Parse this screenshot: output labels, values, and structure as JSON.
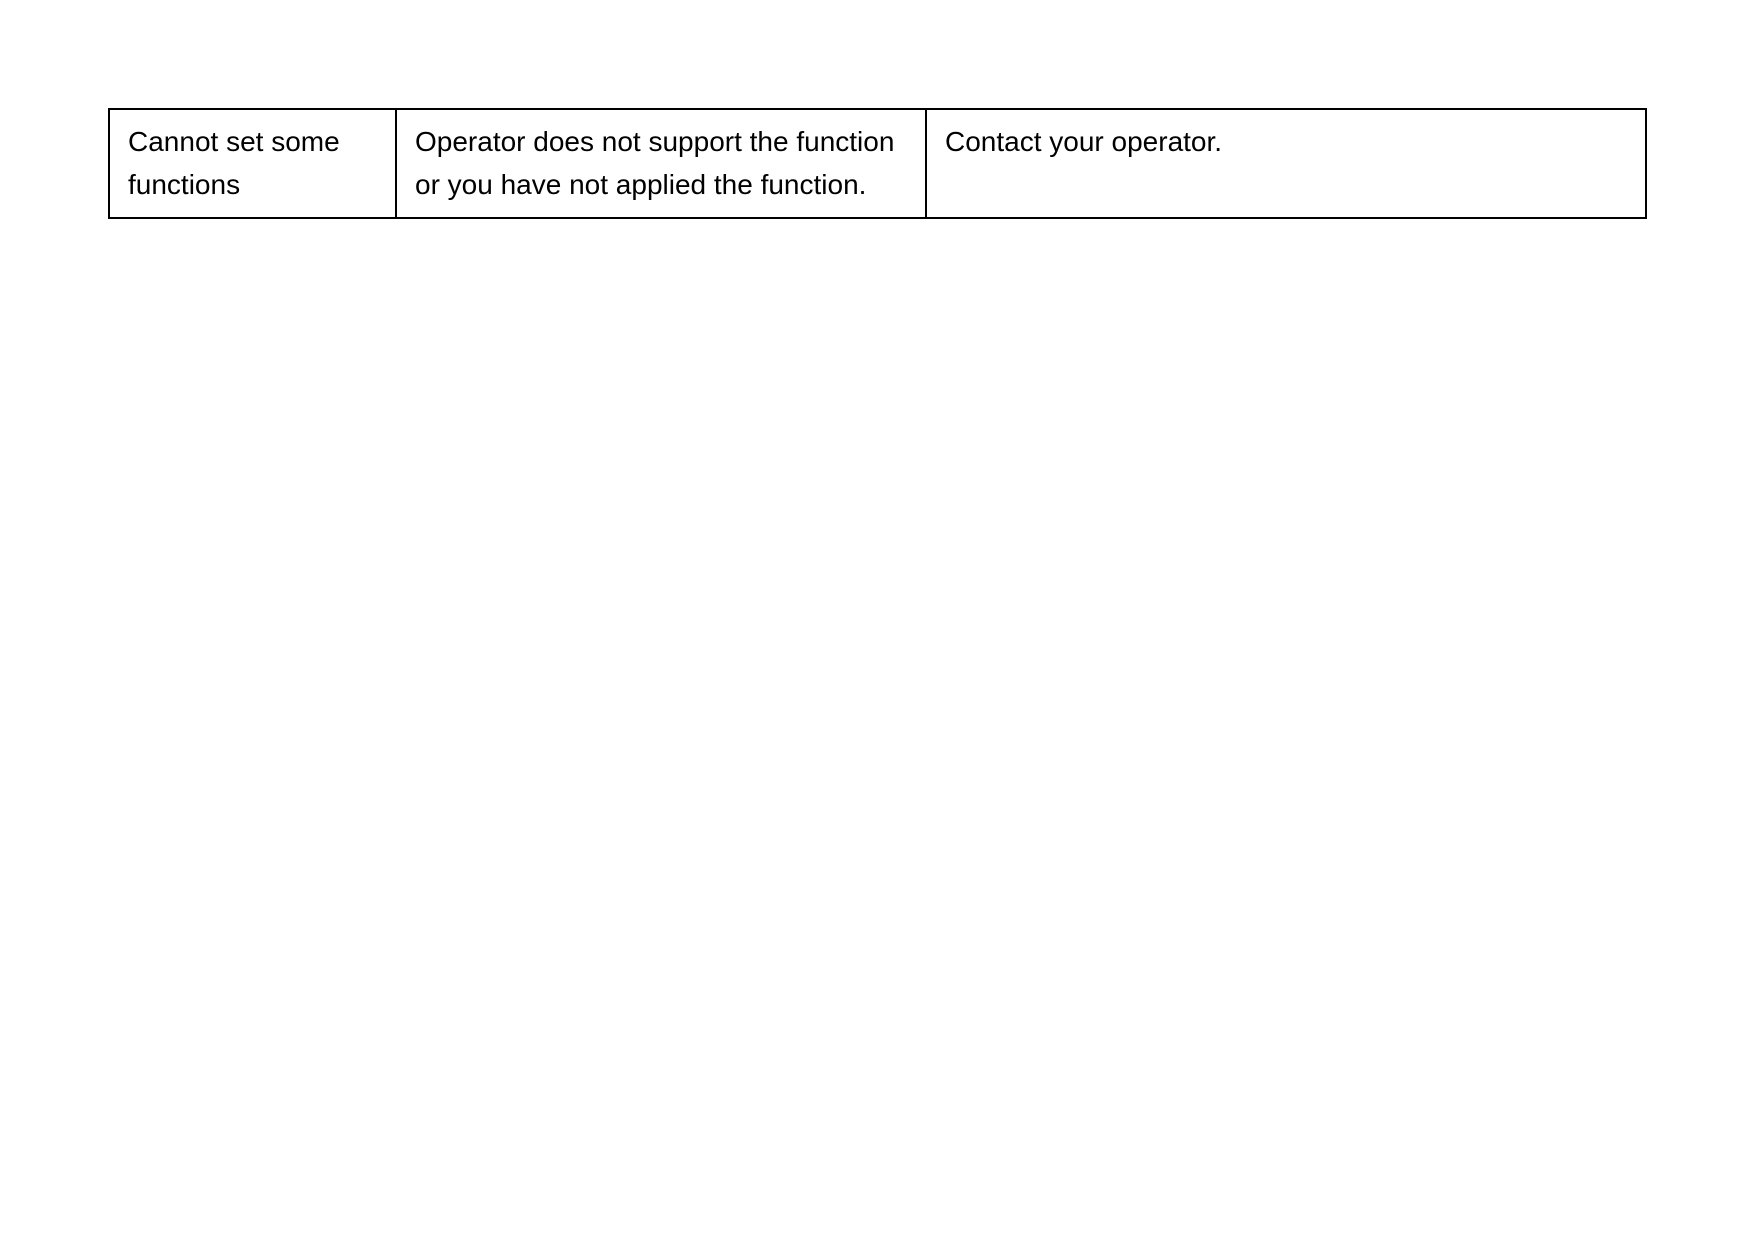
{
  "table": {
    "rows": [
      {
        "problem": "Cannot set some functions",
        "cause": "Operator does not support the function or you have not applied the function.",
        "solution": "Contact your operator."
      }
    ]
  }
}
